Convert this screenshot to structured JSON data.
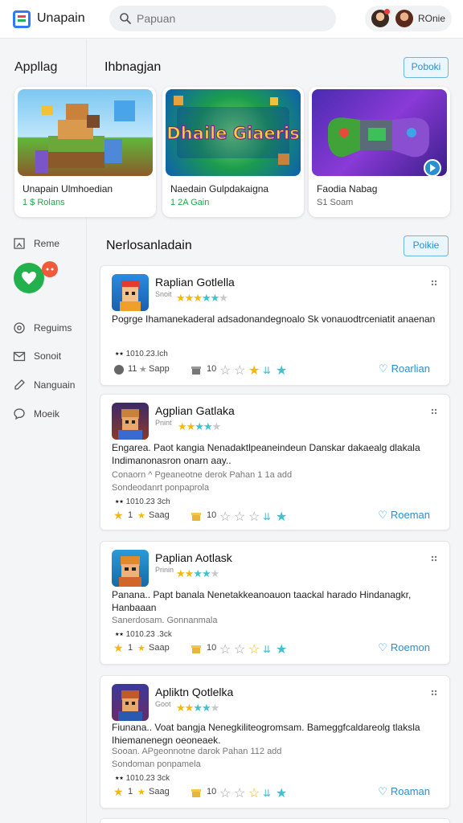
{
  "header": {
    "app_title": "Unapain",
    "search_placeholder": "Papuan",
    "user_name": "ROnie"
  },
  "sidebar": {
    "heading": "Appllag",
    "items": [
      {
        "label": "Reme",
        "icon": "bookmark-icon"
      },
      {
        "label": "Reguims",
        "icon": "settings-icon"
      },
      {
        "label": "Sonoit",
        "icon": "mail-icon"
      },
      {
        "label": "Nanguain",
        "icon": "edit-icon"
      },
      {
        "label": "Moeik",
        "icon": "chat-icon"
      }
    ]
  },
  "featured": {
    "title": "Ihbnagjan",
    "button": "Poboki",
    "cards": [
      {
        "name": "Unapain Ulmhoedian",
        "sub": "1 $ Rolans",
        "sub_color": "#1ea74a"
      },
      {
        "name": "Naedain Gulpdakaigna",
        "sub": "1 2A Gain",
        "sub_color": "#1ea74a"
      },
      {
        "name": "Faodia Nabag",
        "sub": "S1 Soam",
        "sub_color": "#666666"
      }
    ],
    "art_text": "Dhaile Giaeris"
  },
  "list": {
    "title": "Nerlosanladain",
    "button": "Poikie",
    "apps": [
      {
        "name": "Raplian Gotlella",
        "dev": "Snoit",
        "desc": "Pogrge Ihamanekaderal adsadonandegnoalo Sk vonauodtrceniatit anaenan",
        "desc_accent": "Sk",
        "meta": "",
        "meta2": "",
        "metric": "1010.23.Ich",
        "row_count": "11",
        "row_label": "Sapp",
        "row_num": "10",
        "action": "Roarlian"
      },
      {
        "name": "Agplian Gatlaka",
        "dev": "Pnint",
        "desc": "Engarea. Paot kangia Nenadaktlpeaneindeun Danskar dakaealg dlakala Indimanonasron onarn aay..",
        "desc_accent": "",
        "meta": "Conaorn  ^ Pgeaneotne derok Pahan  1 1a add",
        "meta2": "Sondeodanrt ponpaprola",
        "metric": "1010.23 3ch",
        "row_count": "1",
        "row_label": "Saag",
        "row_num": "10",
        "action": "Roeman"
      },
      {
        "name": "Paplian Aotlask",
        "dev": "Prinin",
        "desc": "Panana.. Papt banala Nenetakkeanoauon taackal harado Hindanagkr, Hanbaaan",
        "desc_accent": "",
        "meta": "Sanerdosam. Gonnanmala",
        "meta2": "",
        "metric": "1010.23 .3ck",
        "row_count": "1",
        "row_label": "Saap",
        "row_num": "10",
        "action": "Roemon"
      },
      {
        "name": "Apliktn Qotlelka",
        "dev": "Goot",
        "desc": "Fiunana.. Voat bangja Nenegkiliteogromsam. Bameggfcaldareolg tlaksla Ihiemanenegn oeoneaek.",
        "desc_accent": "",
        "meta": "Sooan.  APgeonnotne darok Pahan  112 add",
        "meta2": "Sondoman ponpamela",
        "metric": "1010.23 3ck",
        "row_count": "1",
        "row_label": "Saag",
        "row_num": "10",
        "action": "Roaman"
      }
    ]
  },
  "colors": {
    "accent_blue": "#2690d6",
    "accent_green": "#22b14c",
    "star_gold": "#f5b70b",
    "star_teal": "#40c1cf"
  }
}
